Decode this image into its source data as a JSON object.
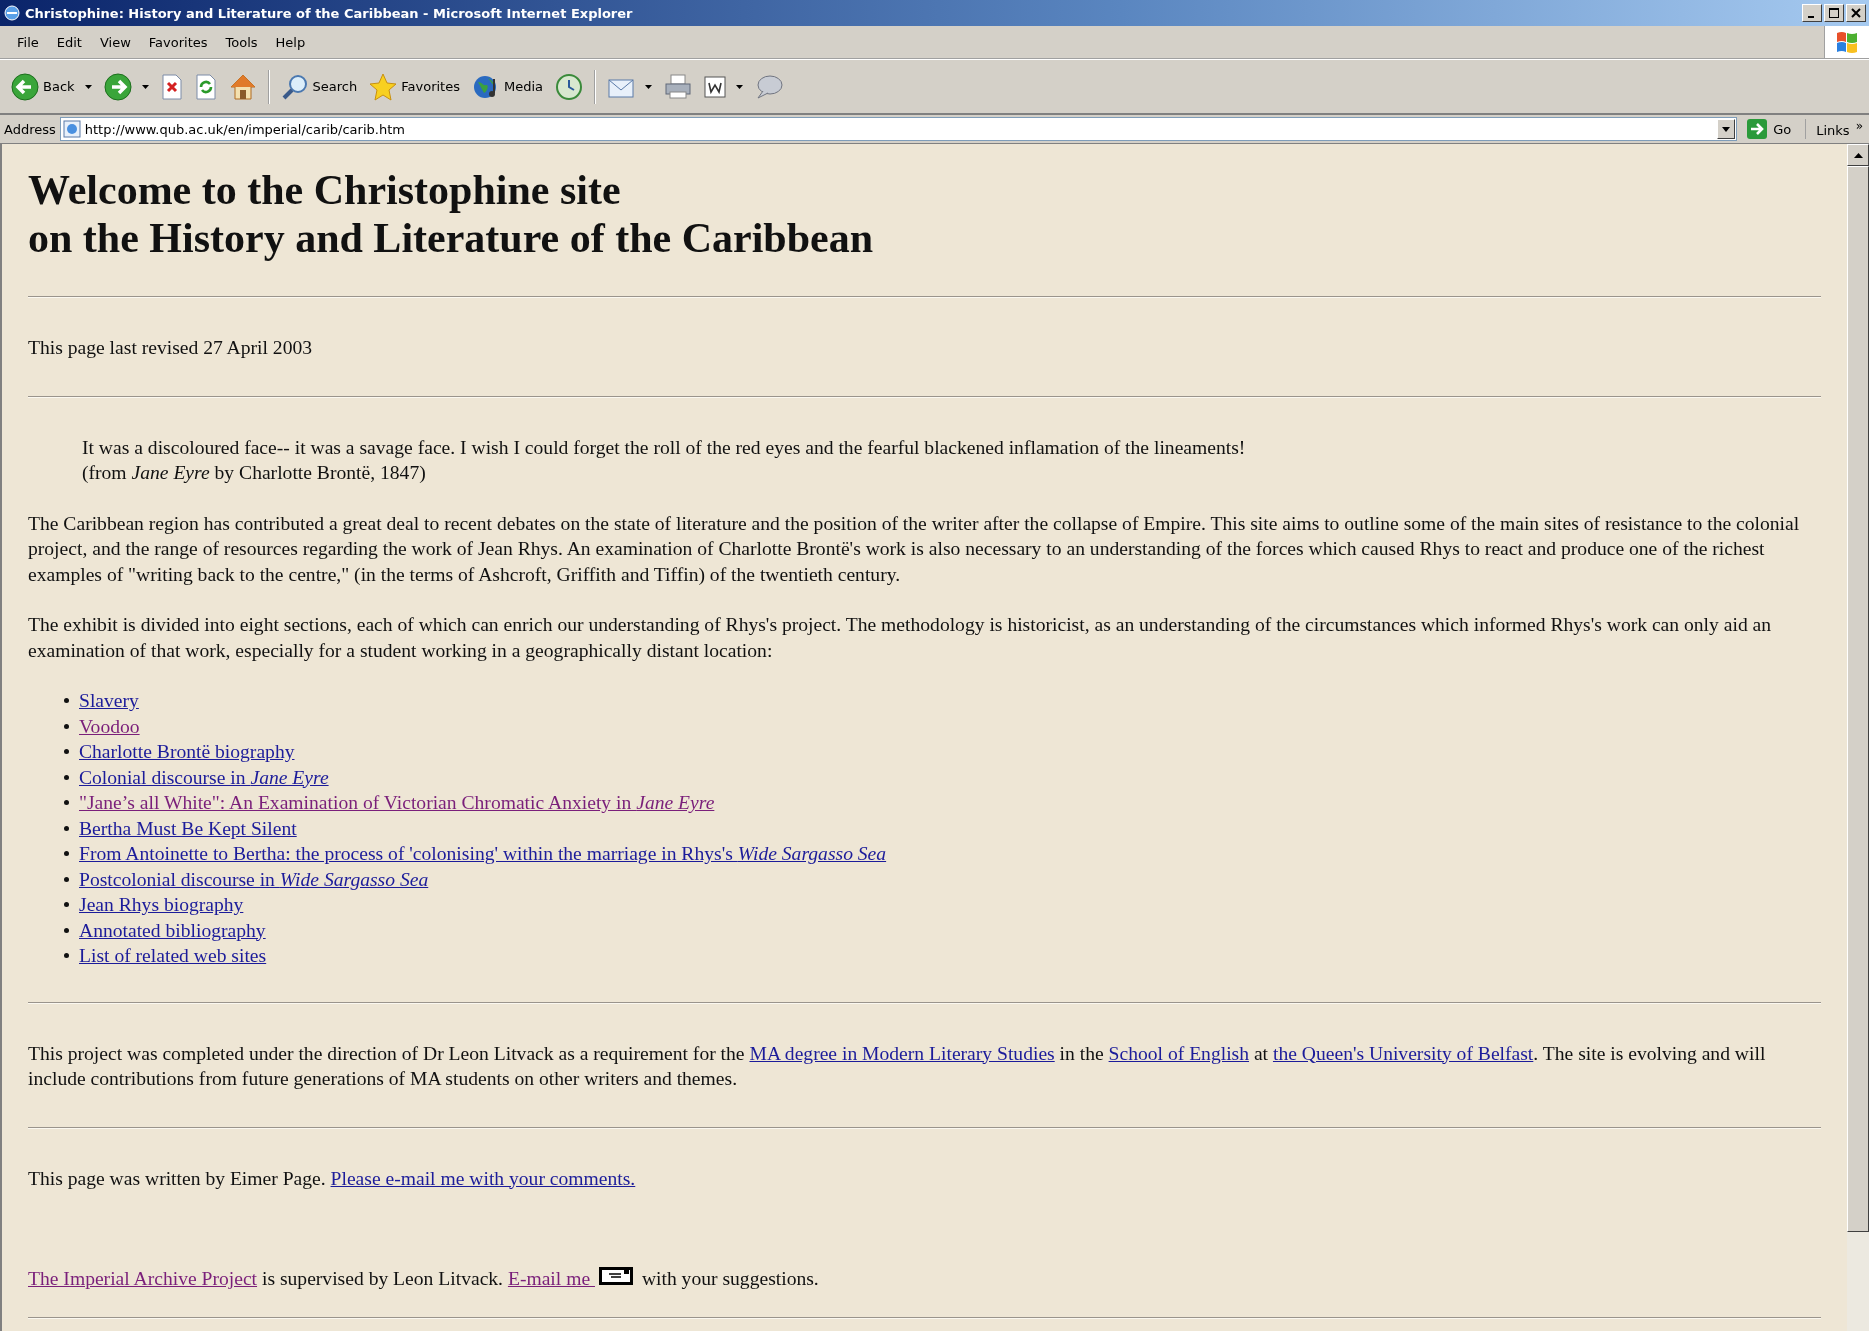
{
  "window": {
    "title": "Christophine: History and Literature of the Caribbean - Microsoft Internet Explorer"
  },
  "menu": [
    "File",
    "Edit",
    "View",
    "Favorites",
    "Tools",
    "Help"
  ],
  "toolbar": {
    "groups": [
      [
        {
          "kind": "back",
          "label": "Back",
          "dropdown": true
        },
        {
          "kind": "forward",
          "dropdown": true
        },
        {
          "kind": "stop",
          "dropdown": false
        },
        {
          "kind": "refresh",
          "dropdown": false
        },
        {
          "kind": "home",
          "dropdown": false
        }
      ],
      [
        {
          "kind": "search",
          "label": "Search",
          "dropdown": false
        },
        {
          "kind": "favorites",
          "label": "Favorites",
          "dropdown": false
        },
        {
          "kind": "media",
          "label": "Media",
          "dropdown": false
        },
        {
          "kind": "history",
          "dropdown": false
        }
      ],
      [
        {
          "kind": "mail",
          "dropdown": true
        },
        {
          "kind": "print",
          "dropdown": false
        },
        {
          "kind": "word",
          "dropdown": true
        },
        {
          "kind": "discuss",
          "dropdown": false
        }
      ]
    ]
  },
  "address": {
    "label": "Address",
    "value": "http://www.qub.ac.uk/en/imperial/carib/carib.htm",
    "go": "Go",
    "links": "Links",
    "links_more": "»"
  },
  "page": {
    "heading": [
      "Welcome to the Christophine site",
      "on the History and Literature of the Caribbean"
    ],
    "revised": "This page last revised 27 April 2003",
    "quote": [
      "It was a discoloured face-- it was a savage face. I wish I could forget the roll of the red eyes and the fearful blackened inflamation of the lineaments!",
      "(from *Jane Eyre* by Charlotte Brontë, 1847)"
    ],
    "intro": [
      "The Caribbean region has contributed a great deal to recent debates on the state of literature and the position of the writer after the collapse of Empire. This site aims to outline some of the main sites of resistance to the colonial project, and the range of resources regarding the work of Jean Rhys. An examination of Charlotte Brontë's work is also necessary to an understanding of the forces which caused Rhys to react and produce one of the richest examples of \"writing back to the centre,\" (in the terms of Ashcroft, Griffith and Tiffin) of the twentieth century.",
      "The exhibit is divided into eight sections, each of which can enrich our understanding of Rhys's project. The methodology is historicist, as an understanding of the circumstances which informed Rhys's work can only aid an examination of that work, especially for a student working in a geographically distant location:"
    ],
    "sections": [
      {
        "text": "Slavery",
        "visited": false
      },
      {
        "text": "Voodoo",
        "visited": true
      },
      {
        "text": "Charlotte Brontë biography",
        "visited": false
      },
      {
        "text": "Colonial discourse in *Jane Eyre*",
        "visited": false
      },
      {
        "text": "\"Jane’s all White\": An Examination of Victorian Chromatic Anxiety in *Jane Eyre*",
        "visited": true
      },
      {
        "text": "Bertha Must Be Kept Silent",
        "visited": false
      },
      {
        "text": "From Antoinette to Bertha: the process of 'colonising' within the marriage in Rhys's *Wide Sargasso Sea*",
        "visited": false
      },
      {
        "text": "Postcolonial discourse in *Wide Sargasso Sea*",
        "visited": false
      },
      {
        "text": "Jean Rhys biography",
        "visited": false
      },
      {
        "text": "Annotated bibliography",
        "visited": false
      },
      {
        "text": "List of related web sites",
        "visited": false
      }
    ],
    "project": [
      {
        "kind": "text",
        "text": "This project was completed under the direction of Dr Leon Litvack as a requirement for the "
      },
      {
        "kind": "link",
        "text": "MA degree in Modern Literary Studies",
        "visited": false
      },
      {
        "kind": "text",
        "text": " in the "
      },
      {
        "kind": "link",
        "text": "School of English",
        "visited": false
      },
      {
        "kind": "text",
        "text": " at "
      },
      {
        "kind": "link",
        "text": "the Queen's University of Belfast",
        "visited": false
      },
      {
        "kind": "text",
        "text": ". The site is evolving and will include contributions from future generations of MA students on other writers and themes."
      }
    ],
    "author": [
      {
        "kind": "text",
        "text": "This page was written by Eimer Page. "
      },
      {
        "kind": "link",
        "text": "Please e-mail me with your comments.",
        "visited": false
      }
    ],
    "archive": [
      {
        "kind": "link",
        "text": "The Imperial Archive Project",
        "visited": true
      },
      {
        "kind": "text",
        "text": " is supervised by Leon Litvack. "
      },
      {
        "kind": "link",
        "text": "E-mail me ",
        "visited": true
      },
      {
        "kind": "icon"
      },
      {
        "kind": "text",
        "text": " with your suggestions."
      }
    ]
  }
}
